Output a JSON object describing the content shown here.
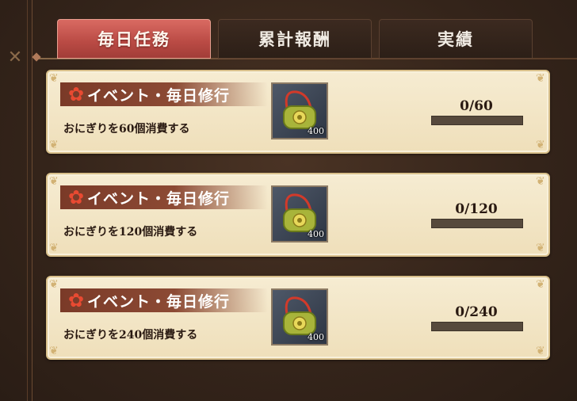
{
  "tabs": [
    {
      "label": "毎日任務",
      "active": true
    },
    {
      "label": "累計報酬",
      "active": false
    },
    {
      "label": "実績",
      "active": false
    }
  ],
  "missions": [
    {
      "category": "イベント・毎日修行",
      "description": "おにぎりを60個消費する",
      "reward_icon": "bag-icon",
      "reward_qty": "400",
      "progress": "0/60",
      "progress_fraction": 0
    },
    {
      "category": "イベント・毎日修行",
      "description": "おにぎりを120個消費する",
      "reward_icon": "bag-icon",
      "reward_qty": "400",
      "progress": "0/120",
      "progress_fraction": 0
    },
    {
      "category": "イベント・毎日修行",
      "description": "おにぎりを240個消費する",
      "reward_icon": "bag-icon",
      "reward_qty": "400",
      "progress": "0/240",
      "progress_fraction": 0
    }
  ],
  "colors": {
    "active_tab": "#b94a44",
    "card_bg": "#f6ecd2",
    "banner": "#8c4a34",
    "bar_bg": "#56493c"
  }
}
